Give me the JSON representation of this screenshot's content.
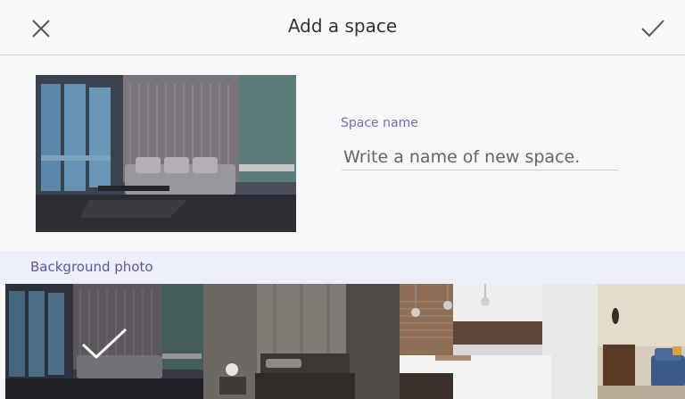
{
  "header": {
    "title": "Add a space",
    "close_icon": "close-icon",
    "confirm_icon": "checkmark-icon"
  },
  "form": {
    "space_name_label": "Space name",
    "space_name_placeholder": "Write a name of new space.",
    "space_name_value": ""
  },
  "background": {
    "section_label": "Background photo",
    "photos": [
      {
        "name": "living-room-teal",
        "selected": true
      },
      {
        "name": "bedroom-gray",
        "selected": false
      },
      {
        "name": "kitchen-white",
        "selected": false
      },
      {
        "name": "living-room-blue-sofa",
        "selected": false
      }
    ]
  },
  "colors": {
    "accent": "#6f6fb5",
    "section_bg": "#eceef9",
    "header_bg": "#f9f9fb"
  }
}
